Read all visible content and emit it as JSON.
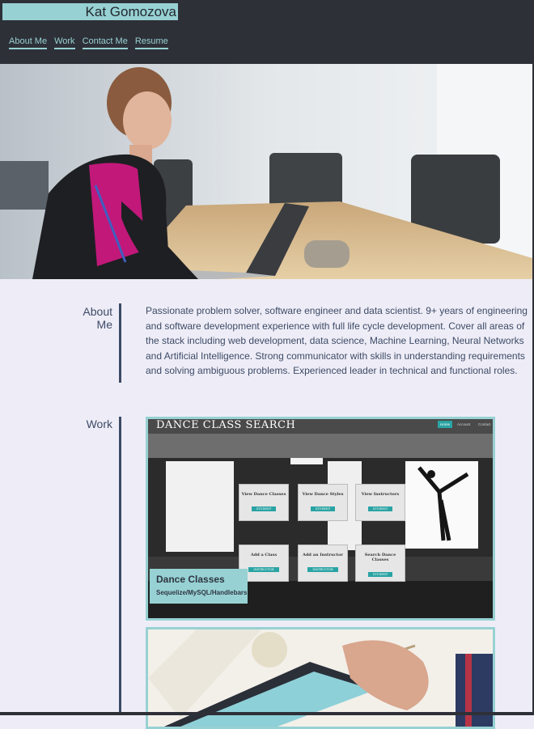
{
  "header": {
    "brand": "Kat Gomozova",
    "nav": [
      "About Me",
      "Work",
      "Contact Me",
      "Resume"
    ]
  },
  "about": {
    "label": "About Me",
    "text": "Passionate problem solver, software engineer and data scientist. 9+ years of engineering and software development experience with full life cycle development. Cover all areas of the stack including web development, data science, Machine Learning, Neural Networks and Artificial Intelligence. Strong communicator with skills in understanding requirements and solving ambiguous problems. Experienced leader in technical and functional roles."
  },
  "work": {
    "label": "Work",
    "projects": [
      {
        "title": "Dance Classes",
        "subtitle": "Sequelize/MySQL/Handlebars",
        "screenshot": {
          "title": "DANCE CLASS SEARCH",
          "nav": [
            "Home",
            "Account",
            "Contact"
          ],
          "tiles": [
            {
              "label": "View Dance Classes",
              "button": "STUDENT"
            },
            {
              "label": "View Dance Styles",
              "button": "STUDENT"
            },
            {
              "label": "View Instructors",
              "button": "STUDENT"
            },
            {
              "label": "Add a Class",
              "button": "INSTRUCTOR"
            },
            {
              "label": "Add an Instructor",
              "button": "INSTRUCTOR"
            },
            {
              "label": "Search Dance Classes",
              "button": "STUDENT"
            }
          ]
        }
      }
    ]
  },
  "colors": {
    "header_bg": "#2e3038",
    "accent": "#97d1d3",
    "text": "#3d4a66",
    "page_bg": "#eeedf7"
  }
}
